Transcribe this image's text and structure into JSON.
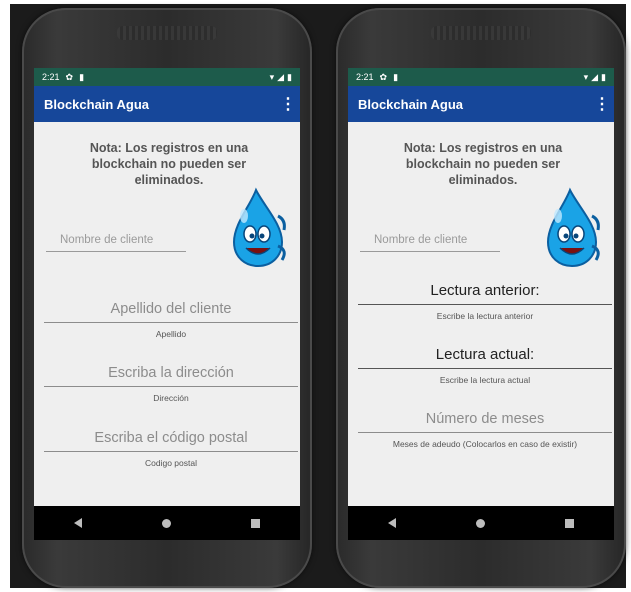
{
  "colors": {
    "status_bar": "#1d5b4b",
    "app_bar": "#16479a",
    "screen_bg": "#efefef"
  },
  "status": {
    "time": "2:21"
  },
  "app": {
    "title": "Blockchain Agua"
  },
  "note": "Nota: Los registros en una blockchain no pueden ser eliminados.",
  "left_screen": {
    "name_placeholder": "Nombre de cliente",
    "fields": [
      {
        "placeholder": "Apellido del cliente",
        "helper": "Apellido"
      },
      {
        "placeholder": "Escriba la dirección",
        "helper": "Dirección"
      },
      {
        "placeholder": "Escriba el código postal",
        "helper": "Codigo postal"
      }
    ]
  },
  "right_screen": {
    "name_placeholder": "Nombre de cliente",
    "fields": [
      {
        "value": "Lectura anterior:",
        "helper": "Escribe la lectura anterior"
      },
      {
        "value": "Lectura actual:",
        "helper": "Escribe la lectura actual"
      },
      {
        "placeholder": "Número de meses",
        "helper": "Meses de adeudo (Colocarlos en caso de existir)"
      }
    ]
  },
  "icons": [
    "settings-icon",
    "sd-card-icon",
    "wifi-icon",
    "signal-icon",
    "battery-icon",
    "overflow-menu-icon",
    "back-icon",
    "home-icon",
    "recents-icon",
    "water-drop-mascot"
  ]
}
